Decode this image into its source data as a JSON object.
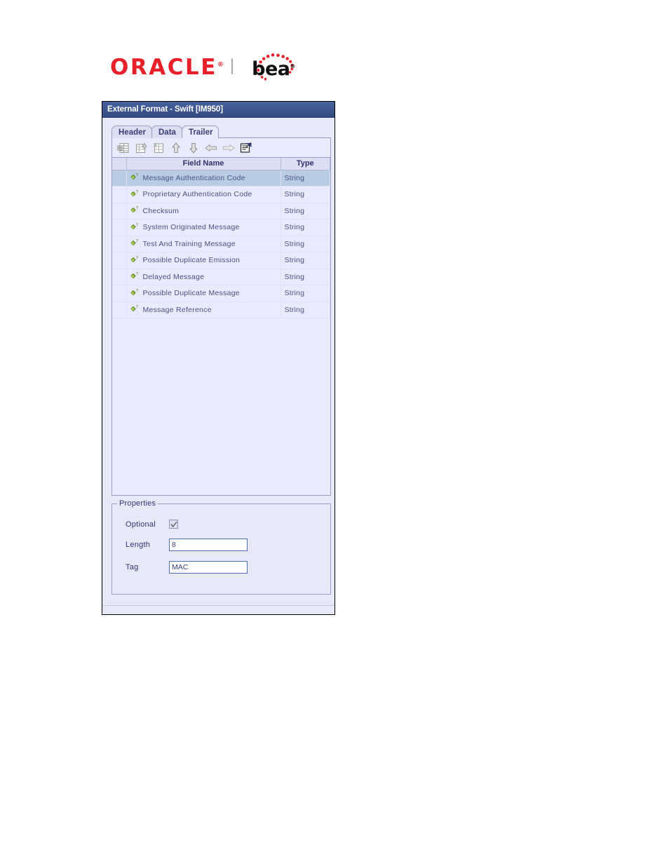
{
  "branding": {
    "oracle_text": "ORACLE",
    "oracle_tm": "®",
    "separator": "|",
    "bea_text": "bea",
    "bea_tm": "®"
  },
  "window": {
    "title": "External Format - Swift [IM950]"
  },
  "tabs": [
    {
      "label": "Header",
      "selected": false
    },
    {
      "label": "Data",
      "selected": false
    },
    {
      "label": "Trailer",
      "selected": true
    }
  ],
  "toolbar": {
    "buttons": [
      {
        "icon": "insert-field-icon",
        "label": "Insert Field",
        "enabled": false
      },
      {
        "icon": "insert-group-icon",
        "label": "Insert Group",
        "enabled": false
      },
      {
        "icon": "delete-field-icon",
        "label": "Delete Field",
        "enabled": false
      },
      {
        "icon": "move-up-icon",
        "label": "Move Up",
        "enabled": false
      },
      {
        "icon": "move-down-icon",
        "label": "Move Down",
        "enabled": false
      },
      {
        "icon": "move-left-icon",
        "label": "Promote",
        "enabled": false
      },
      {
        "icon": "move-right-icon",
        "label": "Demote",
        "enabled": false
      },
      {
        "icon": "properties-icon",
        "label": "Properties",
        "enabled": true
      }
    ]
  },
  "table": {
    "columns": [
      "",
      "Field Name",
      "Type"
    ],
    "rows": [
      {
        "name": "Message Authentication Code",
        "type": "String",
        "icon": "field-diamond-icon",
        "selected": true
      },
      {
        "name": "Proprietary Authentication Code",
        "type": "String",
        "icon": "field-diamond-icon",
        "selected": false
      },
      {
        "name": "Checksum",
        "type": "String",
        "icon": "field-diamond-icon",
        "selected": false
      },
      {
        "name": "System Originated Message",
        "type": "String",
        "icon": "field-diamond-icon",
        "selected": false
      },
      {
        "name": "Test And Training Message",
        "type": "String",
        "icon": "field-diamond-icon",
        "selected": false
      },
      {
        "name": "Possible Duplicate Emission",
        "type": "String",
        "icon": "field-diamond-icon",
        "selected": false
      },
      {
        "name": "Delayed Message",
        "type": "String",
        "icon": "field-diamond-icon",
        "selected": false
      },
      {
        "name": "Possible Duplicate Message",
        "type": "String",
        "icon": "field-diamond-icon",
        "selected": false
      },
      {
        "name": "Message Reference",
        "type": "String",
        "icon": "field-diamond-icon",
        "selected": false
      }
    ]
  },
  "properties": {
    "legend": "Properties",
    "optional_label": "Optional",
    "optional_checked": true,
    "length_label": "Length",
    "length_value": "8",
    "tag_label": "Tag",
    "tag_value": "MAC"
  },
  "colors": {
    "titlebar": "#3d568f",
    "window_bg": "#e7e9f9",
    "row_selected": "#b8cce4",
    "header_bg": "#dcdef2",
    "text": "#3a3f7a",
    "oracle_red": "#e8202a",
    "field_icon_green": "#8fc93a"
  }
}
